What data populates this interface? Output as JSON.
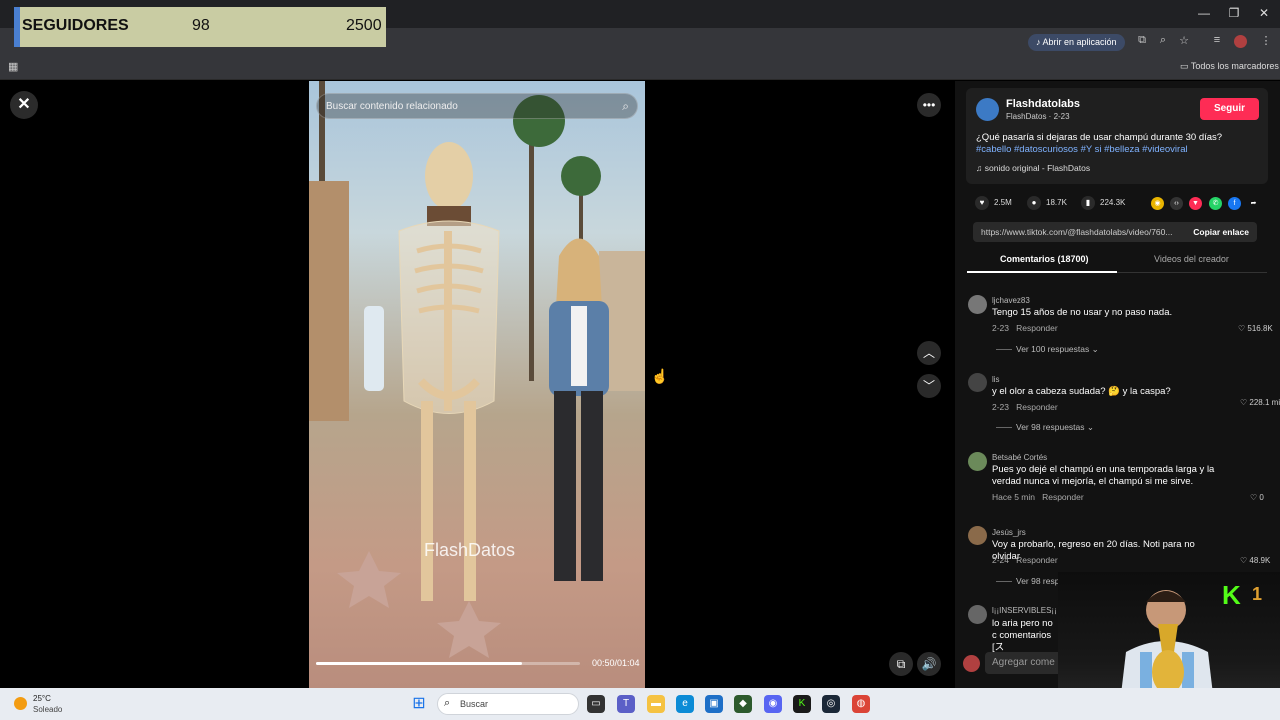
{
  "followers_overlay": {
    "label": "SEGUIDORES",
    "current": "98",
    "goal": "2500"
  },
  "browser": {
    "open_app_label": "Abrir en aplicación",
    "bookmarks_label": "Todos los marcadores"
  },
  "video": {
    "search_placeholder": "Buscar contenido relacionado",
    "watermark": "FlashDatos",
    "time": "00:50/01:04",
    "progress": 0.78
  },
  "author": {
    "name": "Flashdatolabs",
    "sub": "FlashDatos · 2-23",
    "follow_label": "Seguir"
  },
  "post": {
    "description": "¿Qué pasaría si dejaras de usar champú durante 30 días?",
    "hashtags": "#cabello #datoscuriosos #Y si #belleza #videoviral",
    "sound": "sonido original - FlashDatos",
    "likes": "2.5M",
    "comments": "18.7K",
    "saves": "224.3K",
    "link": "https://www.tiktok.com/@flashdatolabs/video/760...",
    "copy_label": "Copiar enlace"
  },
  "tabs": {
    "comments": "Comentarios (18700)",
    "creator_videos": "Videos del creador"
  },
  "comments": [
    {
      "user": "ljchavez83",
      "text": "Tengo 15 años de no usar y no paso nada.",
      "date": "2-23",
      "reply": "Responder",
      "likes": "516.8K",
      "replies": "Ver 100 respuestas"
    },
    {
      "user": "lis",
      "text": "y el olor a cabeza sudada? 🤔 y la caspa?",
      "date": "2-23",
      "reply": "Responder",
      "likes": "228.1 mil",
      "replies": "Ver 98 respuestas"
    },
    {
      "user": "Betsabé Cortés",
      "text": "Pues yo dejé el champú en una temporada larga y la verdad nunca vi mejoría, el champú si me sirve.",
      "date": "Hace 5 min",
      "reply": "Responder",
      "likes": "0"
    },
    {
      "user": "Jesús_jrs",
      "text": "Voy a probarlo, regreso en 20 días. Noti para no olvidar",
      "date": "2-24",
      "reply": "Responder",
      "likes": "48.9K",
      "replies": "Ver 98 resp"
    },
    {
      "user": "l¡¡INSERVIBLES¡¡",
      "text": "lo aria pero no c comentarios [ス"
    }
  ],
  "add_comment_placeholder": "Agregar come",
  "webcam": {
    "kick_number": "1"
  },
  "taskbar": {
    "temp": "25°C",
    "condition": "Soleado",
    "search_placeholder": "Buscar"
  },
  "colors": {
    "accent": "#fe2c55",
    "hashtag": "#7fb2ff",
    "kick": "#53fc18"
  }
}
